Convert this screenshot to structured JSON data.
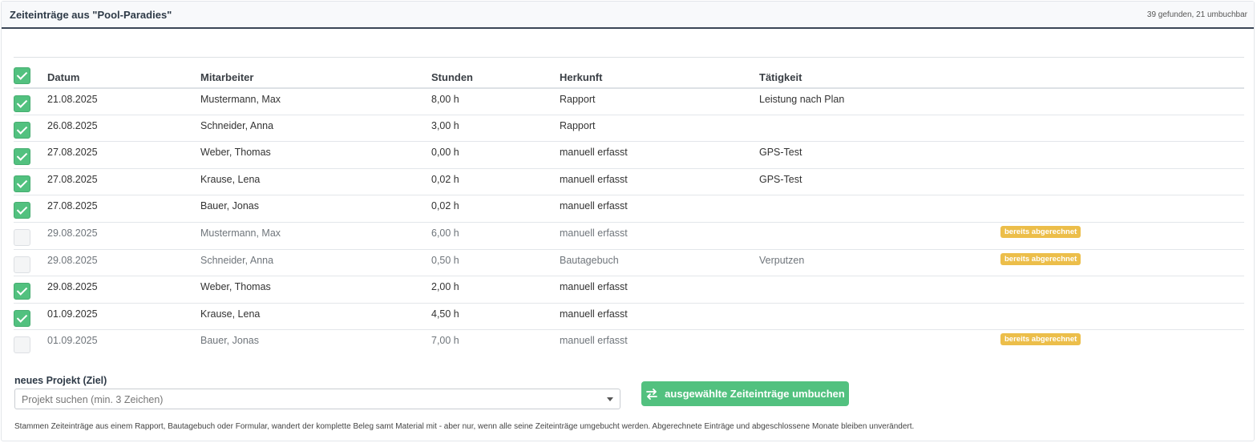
{
  "header": {
    "title": "Zeiteinträge aus \"Pool-Paradies\"",
    "meta": "39 gefunden, 21 umbuchbar"
  },
  "table": {
    "columns": [
      "Datum",
      "Mitarbeiter",
      "Stunden",
      "Herkunft",
      "Tätigkeit"
    ],
    "select_all_checked": true,
    "rows": [
      {
        "checked": true,
        "datum": "21.08.2025",
        "mitarbeiter": "Mustermann, Max",
        "stunden": "8,00 h",
        "herkunft": "Rapport",
        "taetigkeit": "Leistung nach Plan",
        "badge": ""
      },
      {
        "checked": true,
        "datum": "26.08.2025",
        "mitarbeiter": "Schneider, Anna",
        "stunden": "3,00 h",
        "herkunft": "Rapport",
        "taetigkeit": "",
        "badge": ""
      },
      {
        "checked": true,
        "datum": "27.08.2025",
        "mitarbeiter": "Weber, Thomas",
        "stunden": "0,00 h",
        "herkunft": "manuell erfasst",
        "taetigkeit": "GPS-Test",
        "badge": ""
      },
      {
        "checked": true,
        "datum": "27.08.2025",
        "mitarbeiter": "Krause, Lena",
        "stunden": "0,02 h",
        "herkunft": "manuell erfasst",
        "taetigkeit": "GPS-Test",
        "badge": ""
      },
      {
        "checked": true,
        "datum": "27.08.2025",
        "mitarbeiter": "Bauer, Jonas",
        "stunden": "0,02 h",
        "herkunft": "manuell erfasst",
        "taetigkeit": "",
        "badge": ""
      },
      {
        "checked": false,
        "datum": "29.08.2025",
        "mitarbeiter": "Mustermann, Max",
        "stunden": "6,00 h",
        "herkunft": "manuell erfasst",
        "taetigkeit": "",
        "badge": "bereits abgerechnet"
      },
      {
        "checked": false,
        "datum": "29.08.2025",
        "mitarbeiter": "Schneider, Anna",
        "stunden": "0,50 h",
        "herkunft": "Bautagebuch",
        "taetigkeit": "Verputzen",
        "badge": "bereits abgerechnet"
      },
      {
        "checked": true,
        "datum": "29.08.2025",
        "mitarbeiter": "Weber, Thomas",
        "stunden": "2,00 h",
        "herkunft": "manuell erfasst",
        "taetigkeit": "",
        "badge": ""
      },
      {
        "checked": true,
        "datum": "01.09.2025",
        "mitarbeiter": "Krause, Lena",
        "stunden": "4,50 h",
        "herkunft": "manuell erfasst",
        "taetigkeit": "",
        "badge": ""
      },
      {
        "checked": false,
        "datum": "01.09.2025",
        "mitarbeiter": "Bauer, Jonas",
        "stunden": "7,00 h",
        "herkunft": "manuell erfasst",
        "taetigkeit": "",
        "badge": "bereits abgerechnet"
      }
    ]
  },
  "target": {
    "label": "neues Projekt (Ziel)",
    "placeholder": "Projekt suchen (min. 3 Zeichen)"
  },
  "action": {
    "button_label": "ausgewählte Zeiteinträge umbuchen",
    "icon": "transfer-arrows-icon"
  },
  "note": "Stammen Zeiteinträge aus einem Rapport, Bautagebuch oder Formular, wandert der komplette Beleg samt Material mit - aber nur, wenn alle seine Zeiteinträge umgebucht werden. Abgerechnete Einträge und abgeschlossene Monate bleiben unverändert.",
  "colors": {
    "accent": "#52c17f",
    "badge": "#ecbe4a",
    "header_rule": "#3b4656"
  }
}
